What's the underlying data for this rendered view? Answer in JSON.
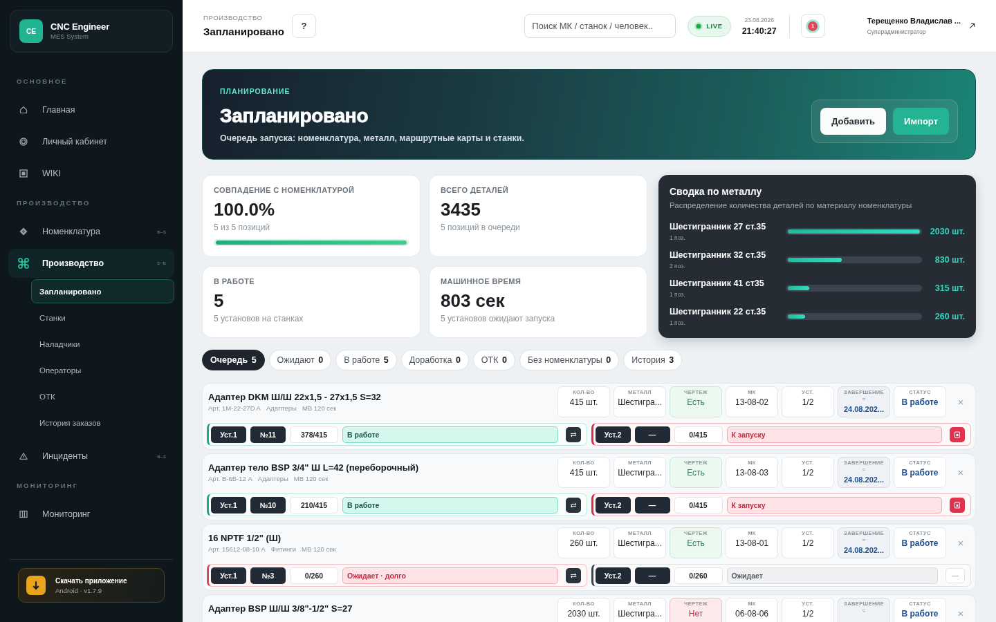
{
  "sidebar": {
    "brand": {
      "logo": "CE",
      "name": "CNC Engineer",
      "subtitle": "MES System"
    },
    "sections": [
      {
        "title": "ОСНОВНОЕ",
        "items": [
          {
            "label": "Главная",
            "selected": false,
            "expanded": false
          },
          {
            "label": "Личный кабинет",
            "selected": false,
            "expanded": false
          },
          {
            "label": "WIKI",
            "selected": false,
            "expanded": false
          }
        ]
      },
      {
        "title": "ПРОИЗВОДСТВО",
        "items": [
          {
            "label": "Номенклатура",
            "toggle": "в–ѕ",
            "selected": false,
            "expanded": false
          },
          {
            "label": "Производство",
            "toggle": "в–ѕ",
            "selected": false,
            "expanded": true,
            "children": [
              {
                "label": "Запланировано",
                "selected": true
              },
              {
                "label": "Станки",
                "selected": false
              },
              {
                "label": "Наладчики",
                "selected": false
              },
              {
                "label": "Операторы",
                "selected": false
              },
              {
                "label": "ОТК",
                "selected": false
              },
              {
                "label": "История заказов",
                "selected": false
              }
            ]
          },
          {
            "label": "Инциденты",
            "toggle": "в–ѕ",
            "selected": false,
            "expanded": false
          }
        ]
      },
      {
        "title": "МОНИТОРИНГ",
        "items": [
          {
            "label": "Мониторинг",
            "selected": false,
            "expanded": false
          }
        ]
      }
    ],
    "download": {
      "title": "Скачать приложение",
      "subtitle": "Android · v1.7.9"
    }
  },
  "header": {
    "breadcrumb": "ПРОИЗВОДСТВО",
    "title": "Запланировано",
    "help": "?",
    "search": {
      "placeholder": "Поиск МК / станок / человек.."
    },
    "live": "LIVE",
    "date": "23.08.2026",
    "time": "21:40:27",
    "notifications": "1",
    "user": {
      "name": "Терещенко Владислав ...",
      "role": "Суперадминистратор"
    }
  },
  "hero": {
    "eyebrow": "ПЛАНИРОВАНИЕ",
    "title": "Запланировано",
    "subtitle": "Очередь запуска: номенклатура, металл, маршрутные карты и станки.",
    "buttons": [
      {
        "label": "Добавить",
        "kind": "secondary"
      },
      {
        "label": "Импорт",
        "kind": "primary"
      }
    ]
  },
  "stats": [
    {
      "label": "СОВПАДЕНИЕ С НОМЕНКЛАТУРОЙ",
      "value": "100.0%",
      "note": "5 из 5 позиций",
      "level": 1
    },
    {
      "label": "ВСЕГО ДЕТАЛЕЙ",
      "value": "3435",
      "note": "5 позиций в очереди"
    },
    {
      "label": "В РАБОТЕ",
      "value": "5",
      "note": "5 установов на станках"
    },
    {
      "label": "МАШИННОЕ ВРЕМЯ",
      "value": "803 сек",
      "note": "5 установов ожидают запуска"
    }
  ],
  "metal": {
    "title": "Сводка по металлу",
    "subtitle": "Распределение количества деталей по материалу номенклатуры",
    "rows": [
      {
        "name": "Шестигранник 27 ст.35",
        "count": "1 поз.",
        "level": 1,
        "total": "2030 шт."
      },
      {
        "name": "Шестигранник 32 ст.35",
        "count": "2 поз.",
        "level": 0.41,
        "total": "830 шт."
      },
      {
        "name": "Шестигранник 41 ст35",
        "count": "1 поз.",
        "level": 0.16,
        "total": "315 шт."
      },
      {
        "name": "Шестигранник 22 ст.35",
        "count": "1 поз.",
        "level": 0.13,
        "total": "260 шт."
      }
    ]
  },
  "tabs": [
    {
      "label": "Очередь",
      "count": "5",
      "selected": true
    },
    {
      "label": "Ожидают",
      "count": "0",
      "selected": false
    },
    {
      "label": "В работе",
      "count": "5",
      "selected": false
    },
    {
      "label": "Доработка",
      "count": "0",
      "selected": false
    },
    {
      "label": "ОТК",
      "count": "0",
      "selected": false
    },
    {
      "label": "Без номенклатуры",
      "count": "0",
      "selected": false
    },
    {
      "label": "История",
      "count": "3",
      "selected": false
    }
  ],
  "orders": [
    {
      "title": "Адаптер DKM Ш/Ш 22x1,5 - 27x1,5 S=32",
      "meta": [
        "Арт. 1М-22-27D A",
        "Адаптеры",
        "МВ 120 сек"
      ],
      "cells": [
        {
          "label": "КОЛ-ВО",
          "value": "415 шт.",
          "kind": "plain"
        },
        {
          "label": "МЕТАЛЛ",
          "value": "Шестигра...",
          "kind": "plain"
        },
        {
          "label": "ЧЕРТЕЖ",
          "value": "Есть",
          "kind": "yes"
        },
        {
          "label": "МК",
          "value": "13-08-02",
          "kind": "plain"
        },
        {
          "label": "УСТ.",
          "value": "1/2",
          "kind": "plain"
        },
        {
          "label": "ЗАВЕРШЕНИЕ",
          "approx": "≈",
          "value": "24.08.202...",
          "kind": "date"
        },
        {
          "label": "СТАТУС",
          "value": "В работе",
          "kind": "status"
        }
      ],
      "close": "×",
      "setups": [
        {
          "label": "Уст.1",
          "machine": "№11",
          "progress": "378/415",
          "status": "В работе",
          "kind": "work"
        },
        {
          "label": "Уст.2",
          "machine": "—",
          "progress": "0/415",
          "status": "К запуску",
          "kind": "launch"
        }
      ]
    },
    {
      "title": "Адаптер тело BSP 3/4\" Ш L=42 (переборочный)",
      "meta": [
        "Арт. В-6В-12 А",
        "Адаптеры",
        "МВ 120 сек"
      ],
      "cells": [
        {
          "label": "КОЛ-ВО",
          "value": "415 шт.",
          "kind": "plain"
        },
        {
          "label": "МЕТАЛЛ",
          "value": "Шестигра...",
          "kind": "plain"
        },
        {
          "label": "ЧЕРТЕЖ",
          "value": "Есть",
          "kind": "yes"
        },
        {
          "label": "МК",
          "value": "13-08-03",
          "kind": "plain"
        },
        {
          "label": "УСТ.",
          "value": "1/2",
          "kind": "plain"
        },
        {
          "label": "ЗАВЕРШЕНИЕ",
          "approx": "≈",
          "value": "24.08.202...",
          "kind": "date"
        },
        {
          "label": "СТАТУС",
          "value": "В работе",
          "kind": "status"
        }
      ],
      "close": "×",
      "setups": [
        {
          "label": "Уст.1",
          "machine": "№10",
          "progress": "210/415",
          "status": "В работе",
          "kind": "work"
        },
        {
          "label": "Уст.2",
          "machine": "—",
          "progress": "0/415",
          "status": "К запуску",
          "kind": "launch"
        }
      ]
    },
    {
      "title": "16 NPTF 1/2\" (Ш)",
      "meta": [
        "Арт. 15612-08-10 А",
        "Фитинги",
        "МВ 120 сек"
      ],
      "cells": [
        {
          "label": "КОЛ-ВО",
          "value": "260 шт.",
          "kind": "plain"
        },
        {
          "label": "МЕТАЛЛ",
          "value": "Шестигра...",
          "kind": "plain"
        },
        {
          "label": "ЧЕРТЕЖ",
          "value": "Есть",
          "kind": "yes"
        },
        {
          "label": "МК",
          "value": "13-08-01",
          "kind": "plain"
        },
        {
          "label": "УСТ.",
          "value": "1/2",
          "kind": "plain"
        },
        {
          "label": "ЗАВЕРШЕНИЕ",
          "approx": "≈",
          "value": "24.08.202...",
          "kind": "date"
        },
        {
          "label": "СТАТУС",
          "value": "В работе",
          "kind": "status"
        }
      ],
      "close": "×",
      "setups": [
        {
          "label": "Уст.1",
          "machine": "№3",
          "progress": "0/260",
          "status": "Ожидает · долго",
          "kind": "late"
        },
        {
          "label": "Уст.2",
          "machine": "—",
          "progress": "0/260",
          "status": "Ожидает",
          "kind": "wait",
          "action": "—"
        }
      ]
    },
    {
      "title": "Адаптер BSP Ш/Ш 3/8\"-1/2\" S=27",
      "cells": [
        {
          "label": "КОЛ-ВО",
          "value": "2030 шт.",
          "kind": "plain"
        },
        {
          "label": "МЕТАЛЛ",
          "value": "Шестигра...",
          "kind": "plain"
        },
        {
          "label": "ЧЕРТЕЖ",
          "value": "Нет",
          "kind": "no"
        },
        {
          "label": "МК",
          "value": "06-08-06",
          "kind": "plain"
        },
        {
          "label": "УСТ.",
          "value": "1/2",
          "kind": "plain"
        },
        {
          "label": "ЗАВЕРШЕНИЕ",
          "approx": "≈",
          "kind": "date"
        },
        {
          "label": "СТАТУС",
          "value": "В работе",
          "kind": "status"
        }
      ],
      "close": "×"
    }
  ]
}
